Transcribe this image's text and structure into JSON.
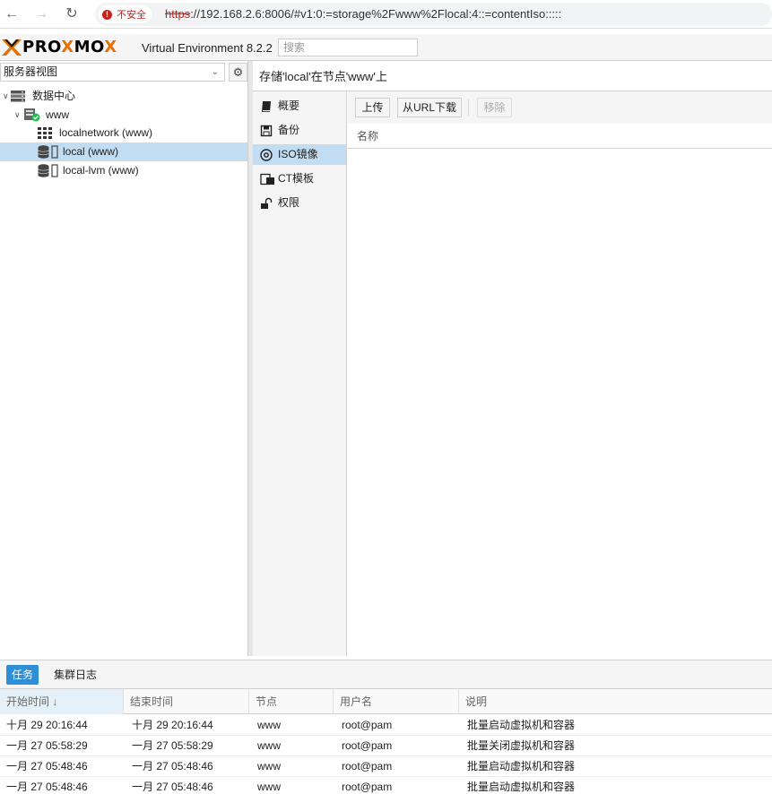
{
  "browser": {
    "insecure_label": "不安全",
    "url_scheme": "https",
    "url_rest": "://192.168.2.6:8006/#v1:0:=storage%2Fwww%2Flocal:4::=contentIso:::::"
  },
  "header": {
    "logo_text_1": "PRO",
    "logo_text_x": "X",
    "logo_text_2": "MO",
    "logo_text_x2": "X",
    "product": "Virtual Environment 8.2.2",
    "search_placeholder": "搜索"
  },
  "tree": {
    "view_label": "服务器视图",
    "items": [
      {
        "label": "数据中心",
        "icon": "datacenter-icon"
      },
      {
        "label": "www",
        "icon": "node-online-icon"
      },
      {
        "label": "localnetwork (www)",
        "icon": "network-grid-icon"
      },
      {
        "label": "local (www)",
        "icon": "storage-icon",
        "selected": true
      },
      {
        "label": "local-lvm (www)",
        "icon": "storage-icon"
      }
    ]
  },
  "content": {
    "title": "存储'local'在节点'www'上",
    "nav": [
      {
        "label": "概要",
        "icon": "book-icon"
      },
      {
        "label": "备份",
        "icon": "floppy-icon"
      },
      {
        "label": "ISO镜像",
        "icon": "disc-icon",
        "active": true
      },
      {
        "label": "CT模板",
        "icon": "template-icon"
      },
      {
        "label": "权限",
        "icon": "unlock-icon"
      }
    ],
    "toolbar": {
      "upload": "上传",
      "download_url": "从URL下载",
      "remove": "移除"
    },
    "grid_header_name": "名称"
  },
  "tasks": {
    "tabs": [
      "任务",
      "集群日志"
    ],
    "columns": [
      "开始时间 ↓",
      "结束时间",
      "节点",
      "用户名",
      "说明"
    ],
    "rows": [
      [
        "十月 29 20:16:44",
        "十月 29 20:16:44",
        "www",
        "root@pam",
        "批量启动虚拟机和容器"
      ],
      [
        "一月 27 05:58:29",
        "一月 27 05:58:29",
        "www",
        "root@pam",
        "批量关闭虚拟机和容器"
      ],
      [
        "一月 27 05:48:46",
        "一月 27 05:48:46",
        "www",
        "root@pam",
        "批量启动虚拟机和容器"
      ],
      [
        "一月 27 05:48:46",
        "一月 27 05:48:46",
        "www",
        "root@pam",
        "批量启动虚拟机和容器"
      ]
    ]
  },
  "colors": {
    "selection": "#c2ddf2",
    "accent_blue": "#2e8fd6",
    "logo_orange": "#e57000",
    "insecure_red": "#c5221f"
  }
}
